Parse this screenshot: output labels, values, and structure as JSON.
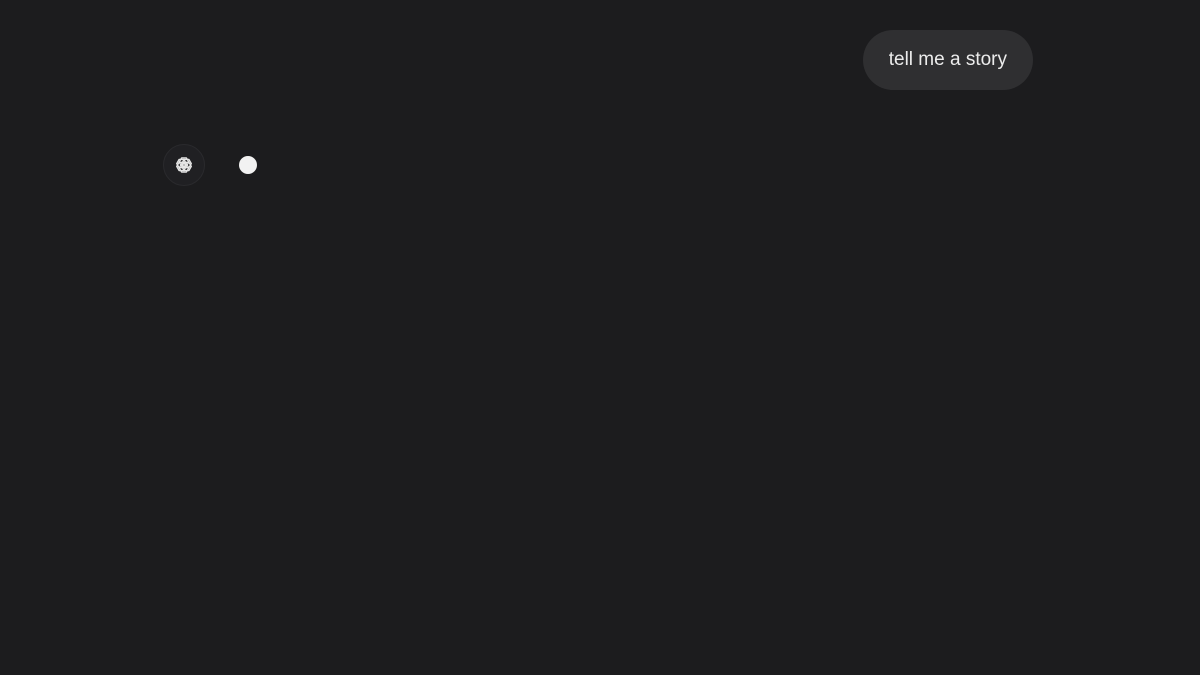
{
  "conversation": {
    "messages": [
      {
        "role": "user",
        "text": "tell me a story"
      },
      {
        "role": "assistant",
        "text": "",
        "status": "typing"
      }
    ]
  },
  "icons": {
    "assistant_avatar": "openai-logo-icon",
    "typing_indicator": "typing-dot"
  },
  "colors": {
    "background": "#1c1c1e",
    "user_bubble": "#2f2f31",
    "text": "#ececec",
    "typing_dot": "#f2f2f2"
  }
}
